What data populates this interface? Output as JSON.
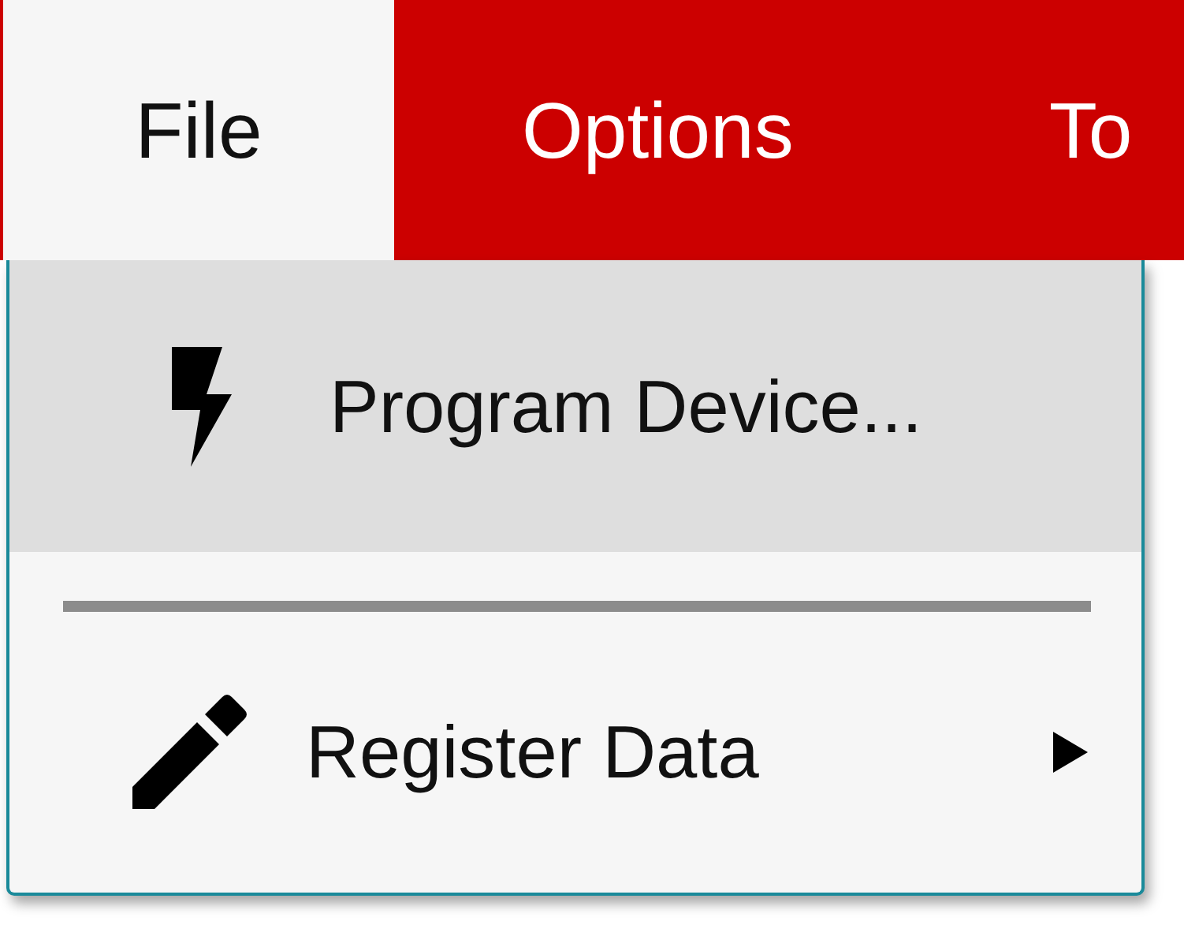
{
  "menubar": [
    {
      "label": "File",
      "selected": true
    },
    {
      "label": "Options",
      "selected": false
    },
    {
      "label": "To",
      "selected": false
    }
  ],
  "menu": {
    "items": [
      {
        "kind": "item",
        "label": "Program Device...",
        "highlighted": true,
        "submenu": false
      },
      {
        "kind": "separator"
      },
      {
        "kind": "item",
        "label": "Register Data",
        "highlighted": false,
        "submenu": true
      }
    ]
  }
}
